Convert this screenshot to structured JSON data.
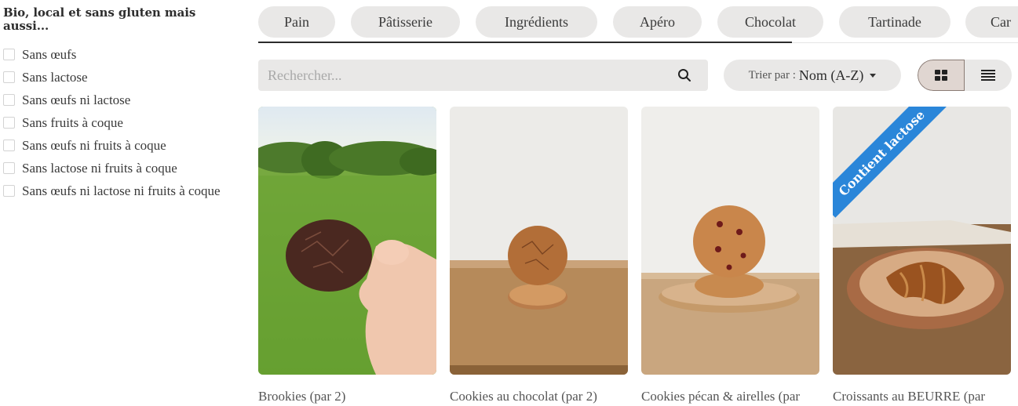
{
  "sidebar": {
    "title": "Bio, local et sans gluten mais aussi...",
    "filters": [
      {
        "label": "Sans œufs",
        "checked": false
      },
      {
        "label": "Sans lactose",
        "checked": false
      },
      {
        "label": "Sans œufs ni lactose",
        "checked": false
      },
      {
        "label": "Sans fruits à coque",
        "checked": false
      },
      {
        "label": "Sans œufs ni fruits à coque",
        "checked": false
      },
      {
        "label": "Sans lactose ni fruits à coque",
        "checked": false
      },
      {
        "label": "Sans œufs ni lactose ni fruits à coque",
        "checked": false
      }
    ]
  },
  "tabs": [
    "Pain",
    "Pâtisserie",
    "Ingrédients",
    "Apéro",
    "Chocolat",
    "Tartinade",
    "Car"
  ],
  "search": {
    "placeholder": "Rechercher...",
    "icon": "search-icon"
  },
  "sort": {
    "label": "Trier par :",
    "value": "Nom (A-Z)"
  },
  "view": {
    "active": "grid",
    "options": [
      "grid-icon",
      "list-icon"
    ]
  },
  "products": [
    {
      "name": "Brookies (par 2)",
      "badge": ""
    },
    {
      "name": "Cookies au chocolat (par 2)",
      "badge": ""
    },
    {
      "name": "Cookies pécan & airelles (par",
      "badge": ""
    },
    {
      "name": "Croissants au BEURRE (par",
      "badge": "Contient lactose"
    }
  ],
  "colors": {
    "chip_bg": "#e9e8e7",
    "badge_blue": "#2a86d9",
    "text": "#333333"
  }
}
